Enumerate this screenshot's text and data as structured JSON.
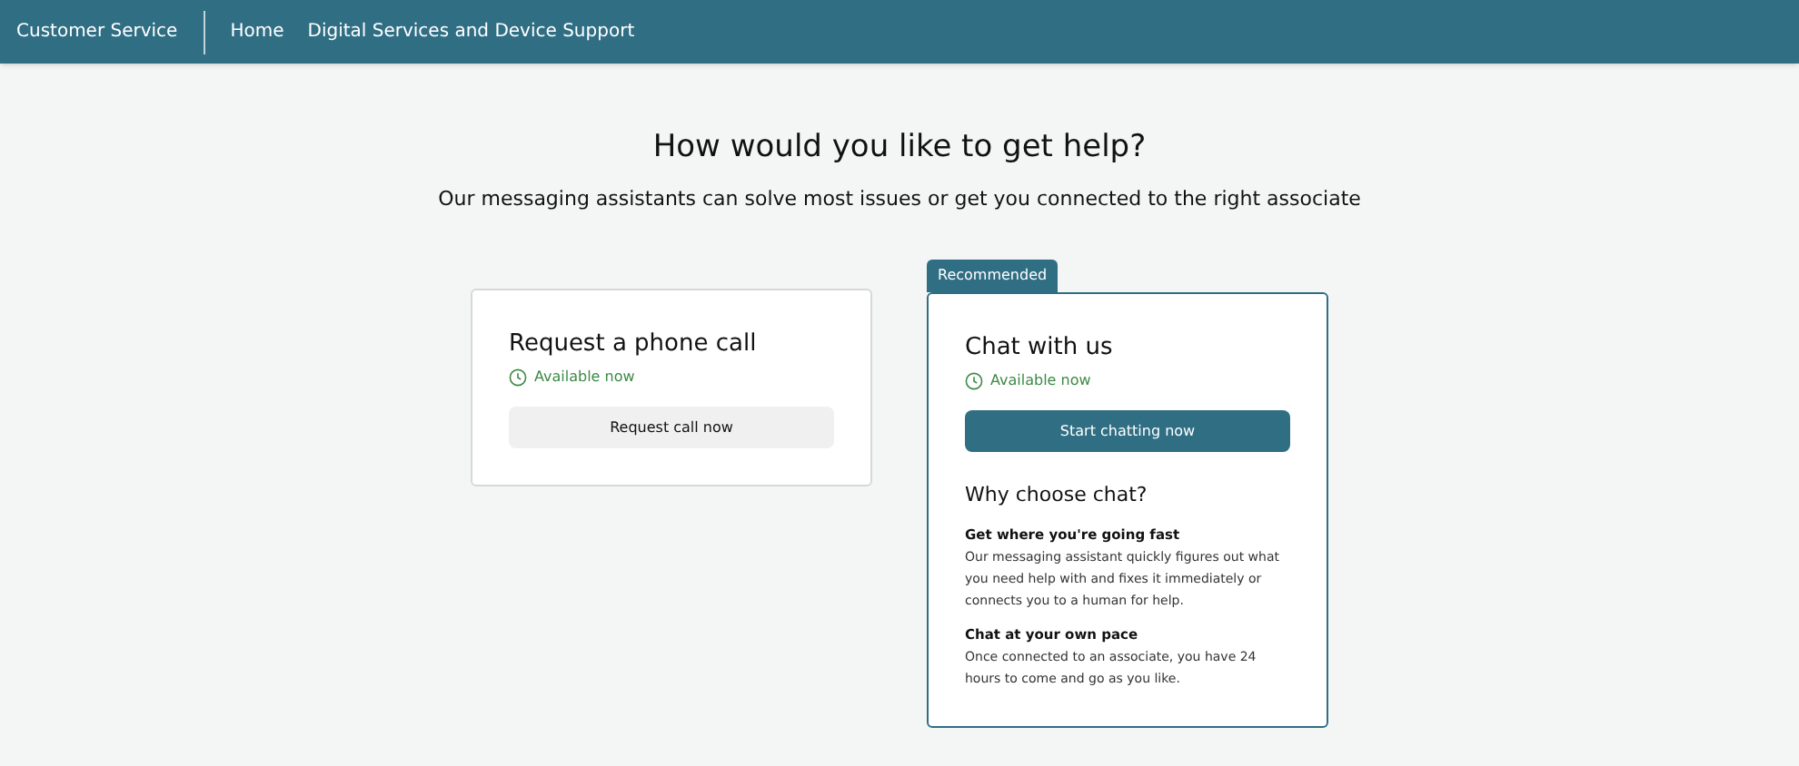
{
  "nav": {
    "brand": "Customer Service",
    "links": [
      "Home",
      "Digital Services and Device Support"
    ]
  },
  "heading": "How would you like to get help?",
  "subheading": "Our messaging assistants can solve most issues or get you connected to the right associate",
  "options": [
    {
      "title": "Request a phone call",
      "availability": "Available now",
      "button": "Request call now",
      "primary": false
    },
    {
      "badge": "Recommended",
      "title": "Chat with us",
      "availability": "Available now",
      "button": "Start chatting now",
      "primary": true,
      "why": {
        "title": "Why choose chat?",
        "points": [
          {
            "title": "Get where you're going fast",
            "text": "Our messaging assistant quickly figures out what you need help with and fixes it immediately or connects you to a human for help."
          },
          {
            "title": "Chat at your own pace",
            "text": "Once connected to an associate, you have 24 hours to come and go as you like."
          }
        ]
      }
    }
  ]
}
